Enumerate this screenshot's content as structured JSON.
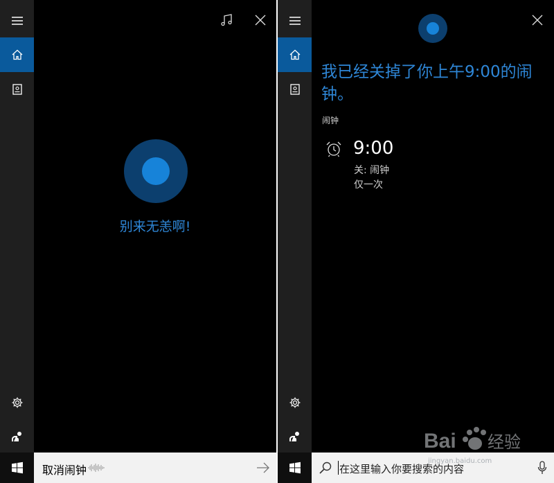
{
  "left_panel": {
    "greeting": "别来无恙啊!",
    "query": "取消闹钟"
  },
  "right_panel": {
    "response": "我已经关掉了你上午9:00的闹钟。",
    "section_label": "闹钟",
    "alarm": {
      "time": "9:00",
      "status": "关: 闹钟",
      "repeat": "仅一次"
    },
    "search_placeholder": "在这里输入你要搜索的内容"
  },
  "watermark": {
    "brand": "Baidu经验",
    "url": "jingyan.baidu.com"
  },
  "icons": {
    "menu": "hamburger-menu-icon",
    "home": "home-icon",
    "notebook": "notebook-icon",
    "settings": "gear-icon",
    "feedback": "feedback-icon",
    "music": "music-note-icon",
    "close": "close-icon",
    "start": "windows-logo-icon",
    "search": "search-icon",
    "mic": "microphone-icon",
    "alarm": "alarm-clock-icon"
  },
  "colors": {
    "accent": "#2e86d6",
    "rail_active": "#0a5a9c",
    "cortana_inner": "#1783d9",
    "cortana_outer": "#0c3f6e"
  }
}
